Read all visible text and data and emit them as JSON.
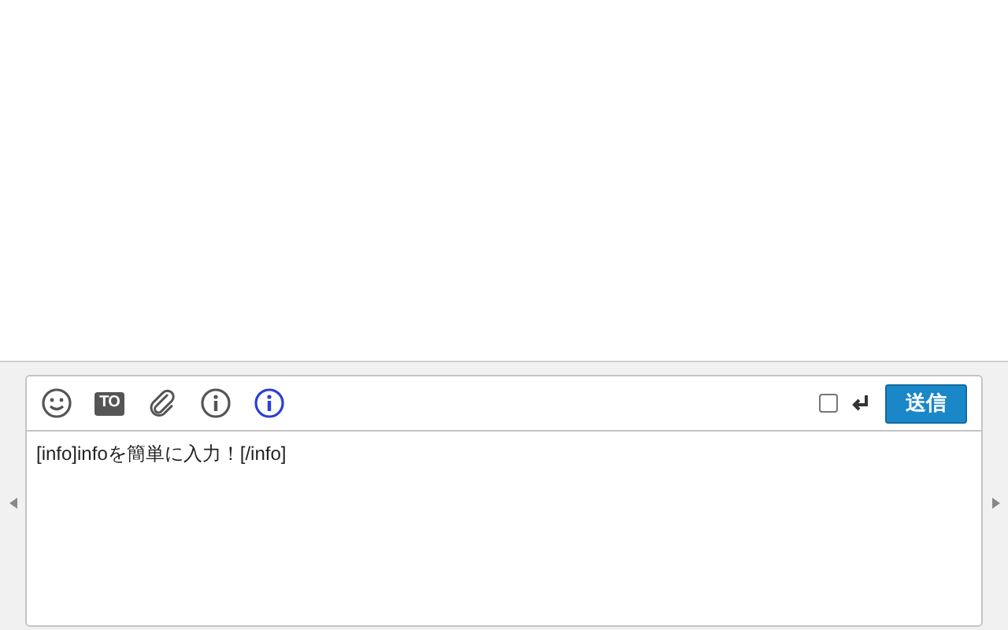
{
  "toolbar": {
    "tools": [
      {
        "kind": "emoji",
        "selected": false
      },
      {
        "kind": "to",
        "label": "TO",
        "selected": false
      },
      {
        "kind": "attach",
        "selected": false
      },
      {
        "kind": "info",
        "selected": false
      },
      {
        "kind": "info",
        "selected": true
      }
    ],
    "enter_to_send": {
      "checked": false
    },
    "send_button": "送信"
  },
  "message": {
    "value": "[info]infoを簡単に入力！[/info]"
  }
}
